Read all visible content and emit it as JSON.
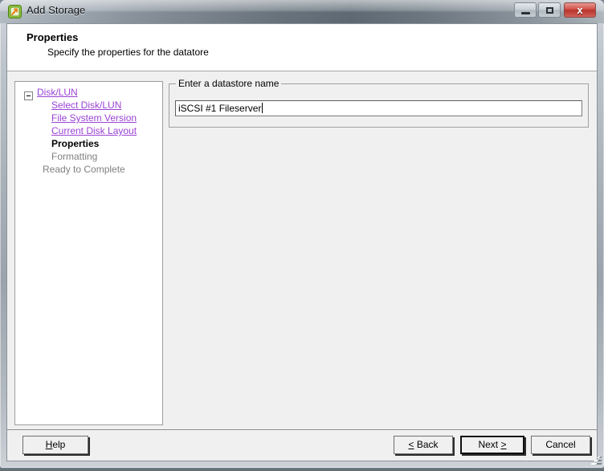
{
  "window": {
    "title": "Add Storage",
    "icon": "add-storage-icon",
    "controls": {
      "minimize_label": "Minimize",
      "maximize_label": "Maximize",
      "close_label": "x"
    }
  },
  "header": {
    "title": "Properties",
    "subtitle": "Specify the properties for the datatore"
  },
  "sidebar": {
    "items": [
      {
        "label": "Disk/LUN",
        "state": "link",
        "level": 0,
        "has_toggle": true,
        "toggle": "collapse-minus"
      },
      {
        "label": "Select Disk/LUN",
        "state": "link",
        "level": 1,
        "has_toggle": false
      },
      {
        "label": "File System Version",
        "state": "link",
        "level": 1,
        "has_toggle": false
      },
      {
        "label": "Current Disk Layout",
        "state": "link",
        "level": 1,
        "has_toggle": false
      },
      {
        "label": "Properties",
        "state": "current",
        "level": 1,
        "has_toggle": false
      },
      {
        "label": "Formatting",
        "state": "disabled",
        "level": 1,
        "has_toggle": false
      },
      {
        "label": "Ready to Complete",
        "state": "disabled",
        "level": 0,
        "has_toggle": false
      }
    ]
  },
  "content": {
    "groupbox_label": "Enter a datastore name",
    "datastore_name_value": "iSCSI #1 Fileserver",
    "datastore_name_placeholder": ""
  },
  "footer": {
    "help_label": "Help",
    "help_mnemonic": "H",
    "back_label": "Back",
    "back_prefix": "<",
    "next_label": "Next",
    "next_suffix": ">",
    "cancel_label": "Cancel"
  },
  "colors": {
    "link": "#9a43d6",
    "disabled": "#808080",
    "panel_bg": "#f0f0f0",
    "field_bg": "#ffffff",
    "close_button": "#c8403a"
  }
}
